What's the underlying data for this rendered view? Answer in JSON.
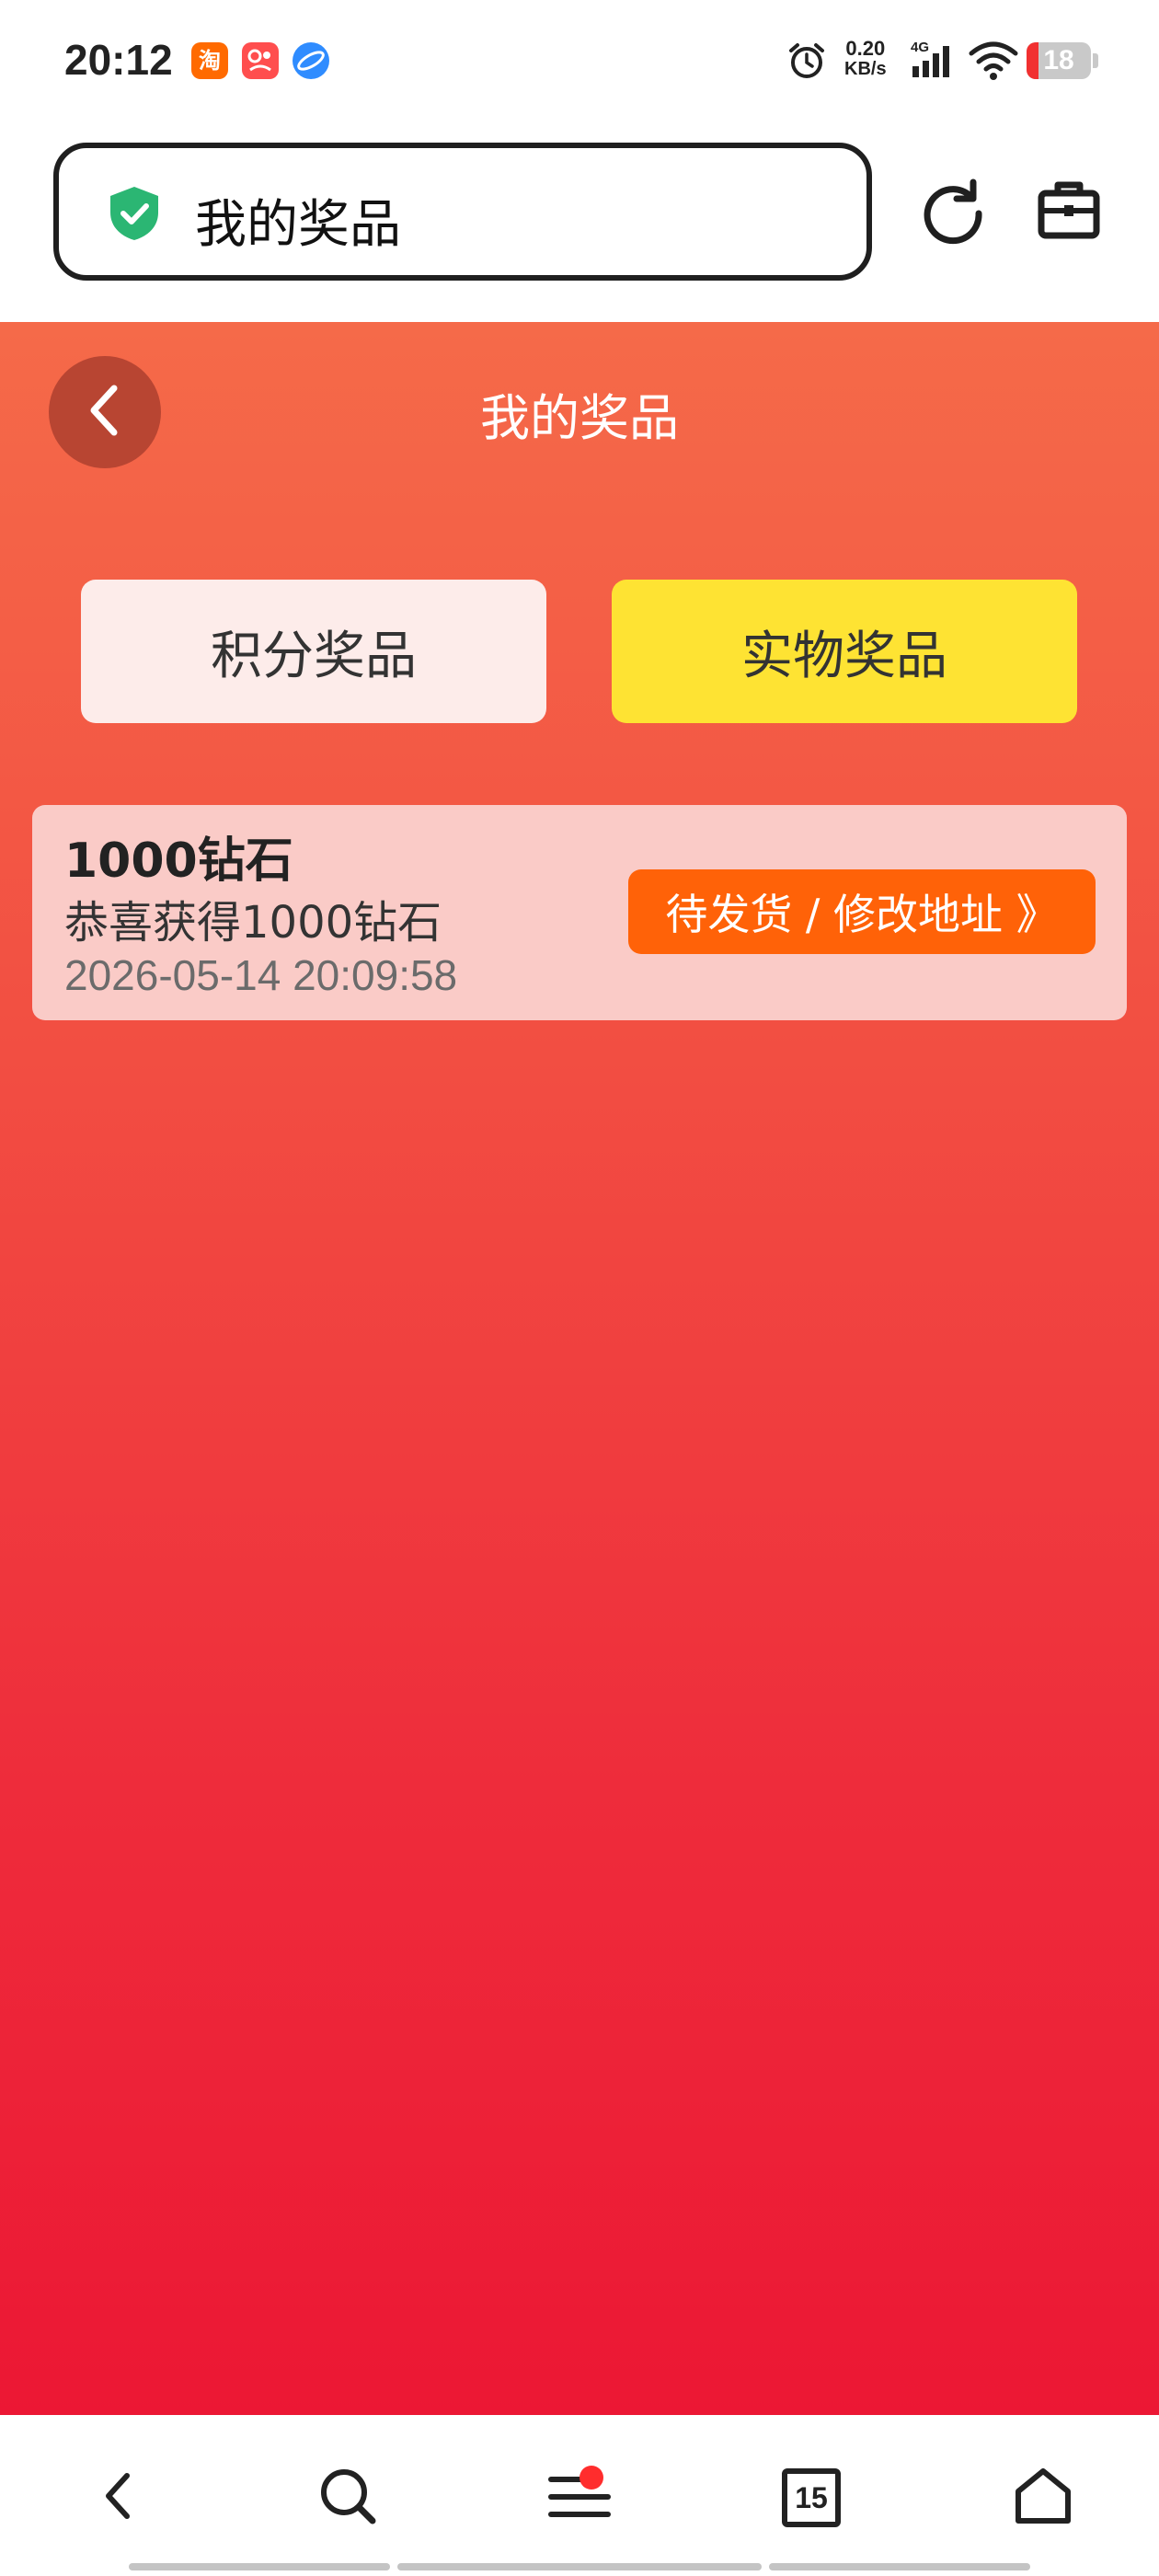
{
  "status_bar": {
    "time": "20:12",
    "app_icons": [
      "淘",
      "㐀",
      ""
    ],
    "net_speed_value": "0.20",
    "net_speed_unit": "KB/s",
    "network_type": "4G",
    "battery_level": "18",
    "icons": [
      "alarm-icon",
      "signal-icon",
      "wifi-icon",
      "battery-icon"
    ]
  },
  "browser": {
    "address_text": "我的奖品",
    "icons": [
      "shield-check-icon",
      "reload-icon",
      "toolbox-icon"
    ]
  },
  "page": {
    "title": "我的奖品",
    "tabs": [
      {
        "label": "积分奖品",
        "active": false
      },
      {
        "label": "实物奖品",
        "active": true
      }
    ],
    "prizes": [
      {
        "name": "1000钻石",
        "description": "恭喜获得1000钻石",
        "date": "2026-05-14 20:09:58",
        "action_label": "待发货 / 修改地址 》"
      }
    ]
  },
  "bottom_nav": {
    "tab_count": "15",
    "icons": [
      "back-icon",
      "search-icon",
      "menu-icon",
      "tabs-icon",
      "home-icon"
    ]
  },
  "colors": {
    "gradient_top": "#f56a49",
    "gradient_bottom": "#ec1734",
    "active_tab": "#fee333",
    "inactive_tab": "#fdecea",
    "card_bg": "#facbc7",
    "action_button": "#ff6208"
  }
}
